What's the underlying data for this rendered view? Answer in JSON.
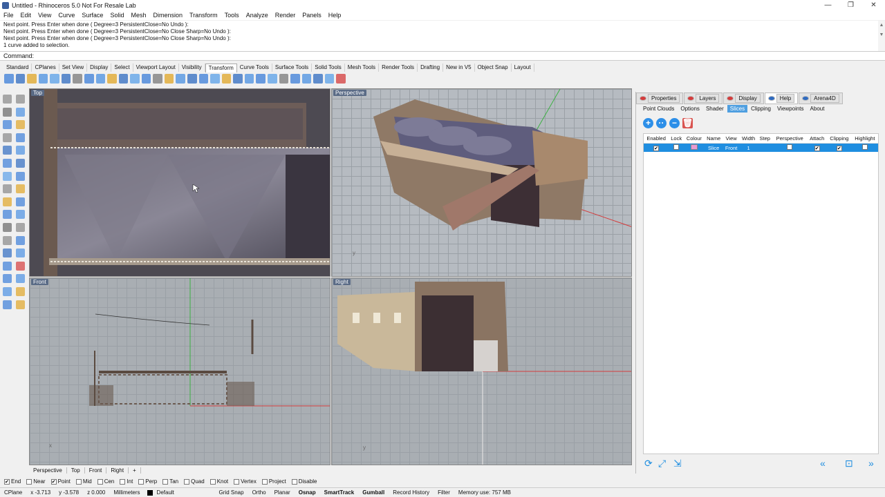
{
  "window": {
    "title": "Untitled - Rhinoceros 5.0 Not For Resale Lab"
  },
  "menu": [
    "File",
    "Edit",
    "View",
    "Curve",
    "Surface",
    "Solid",
    "Mesh",
    "Dimension",
    "Transform",
    "Tools",
    "Analyze",
    "Render",
    "Panels",
    "Help"
  ],
  "command_history": [
    "Next point. Press Enter when done ( Degree=3  PersistentClose=No  Undo ):",
    "Next point. Press Enter when done ( Degree=3  PersistentClose=No  Close  Sharp=No  Undo ):",
    "Next point. Press Enter when done ( Degree=3  PersistentClose=No  Close  Sharp=No  Undo ):",
    "1 curve added to selection."
  ],
  "command": {
    "label": "Command:",
    "value": ""
  },
  "toolbar_tabs": [
    "Standard",
    "CPlanes",
    "Set View",
    "Display",
    "Select",
    "Viewport Layout",
    "Visibility",
    "Transform",
    "Curve Tools",
    "Surface Tools",
    "Solid Tools",
    "Mesh Tools",
    "Render Tools",
    "Drafting",
    "New in V5",
    "Object Snap",
    "Layout"
  ],
  "active_toolbar_tab": "Transform",
  "viewports": {
    "top": "Top",
    "perspective": "Perspective",
    "front": "Front",
    "right": "Right"
  },
  "viewport_tabs": [
    "Perspective",
    "Top",
    "Front",
    "Right",
    "+"
  ],
  "panel": {
    "tabs": [
      "Properties",
      "Layers",
      "Display",
      "Help",
      "Arena4D"
    ],
    "subtabs": [
      "Point Clouds",
      "Options",
      "Shader",
      "Slices",
      "Clipping",
      "Viewpoints",
      "About"
    ],
    "active_subtab": "Slices",
    "tool_icons": [
      "add-icon",
      "duplicate-icon",
      "remove-icon",
      "trash-icon"
    ],
    "table": {
      "columns": [
        "Enabled",
        "Lock",
        "Colour",
        "Name",
        "View",
        "Width",
        "Step",
        "Perspective",
        "Attach",
        "Clipping",
        "Highlight"
      ],
      "rows": [
        {
          "enabled": "✔",
          "lock": "",
          "colour": "#e89ad3",
          "name": "Slice",
          "view": "Front",
          "width": "1",
          "step": "",
          "perspective": "",
          "attach": "✔",
          "clipping": "✔",
          "highlight": ""
        }
      ]
    }
  },
  "osnaps": [
    {
      "label": "End",
      "checked": true
    },
    {
      "label": "Near",
      "checked": false
    },
    {
      "label": "Point",
      "checked": true
    },
    {
      "label": "Mid",
      "checked": false
    },
    {
      "label": "Cen",
      "checked": false
    },
    {
      "label": "Int",
      "checked": false
    },
    {
      "label": "Perp",
      "checked": false
    },
    {
      "label": "Tan",
      "checked": false
    },
    {
      "label": "Quad",
      "checked": false
    },
    {
      "label": "Knot",
      "checked": false
    },
    {
      "label": "Vertex",
      "checked": false
    },
    {
      "label": "Project",
      "checked": false
    },
    {
      "label": "Disable",
      "checked": false
    }
  ],
  "status": {
    "cplane": "CPlane",
    "x": "x -3.713",
    "y": "y -3.578",
    "z": "z 0.000",
    "units": "Millimeters",
    "layer": "Default",
    "grid_snap": "Grid Snap",
    "ortho": "Ortho",
    "planar": "Planar",
    "osnap": "Osnap",
    "smarttrack": "SmartTrack",
    "gumball": "Gumball",
    "record_history": "Record History",
    "filter": "Filter",
    "memory": "Memory use: 757 MB"
  }
}
